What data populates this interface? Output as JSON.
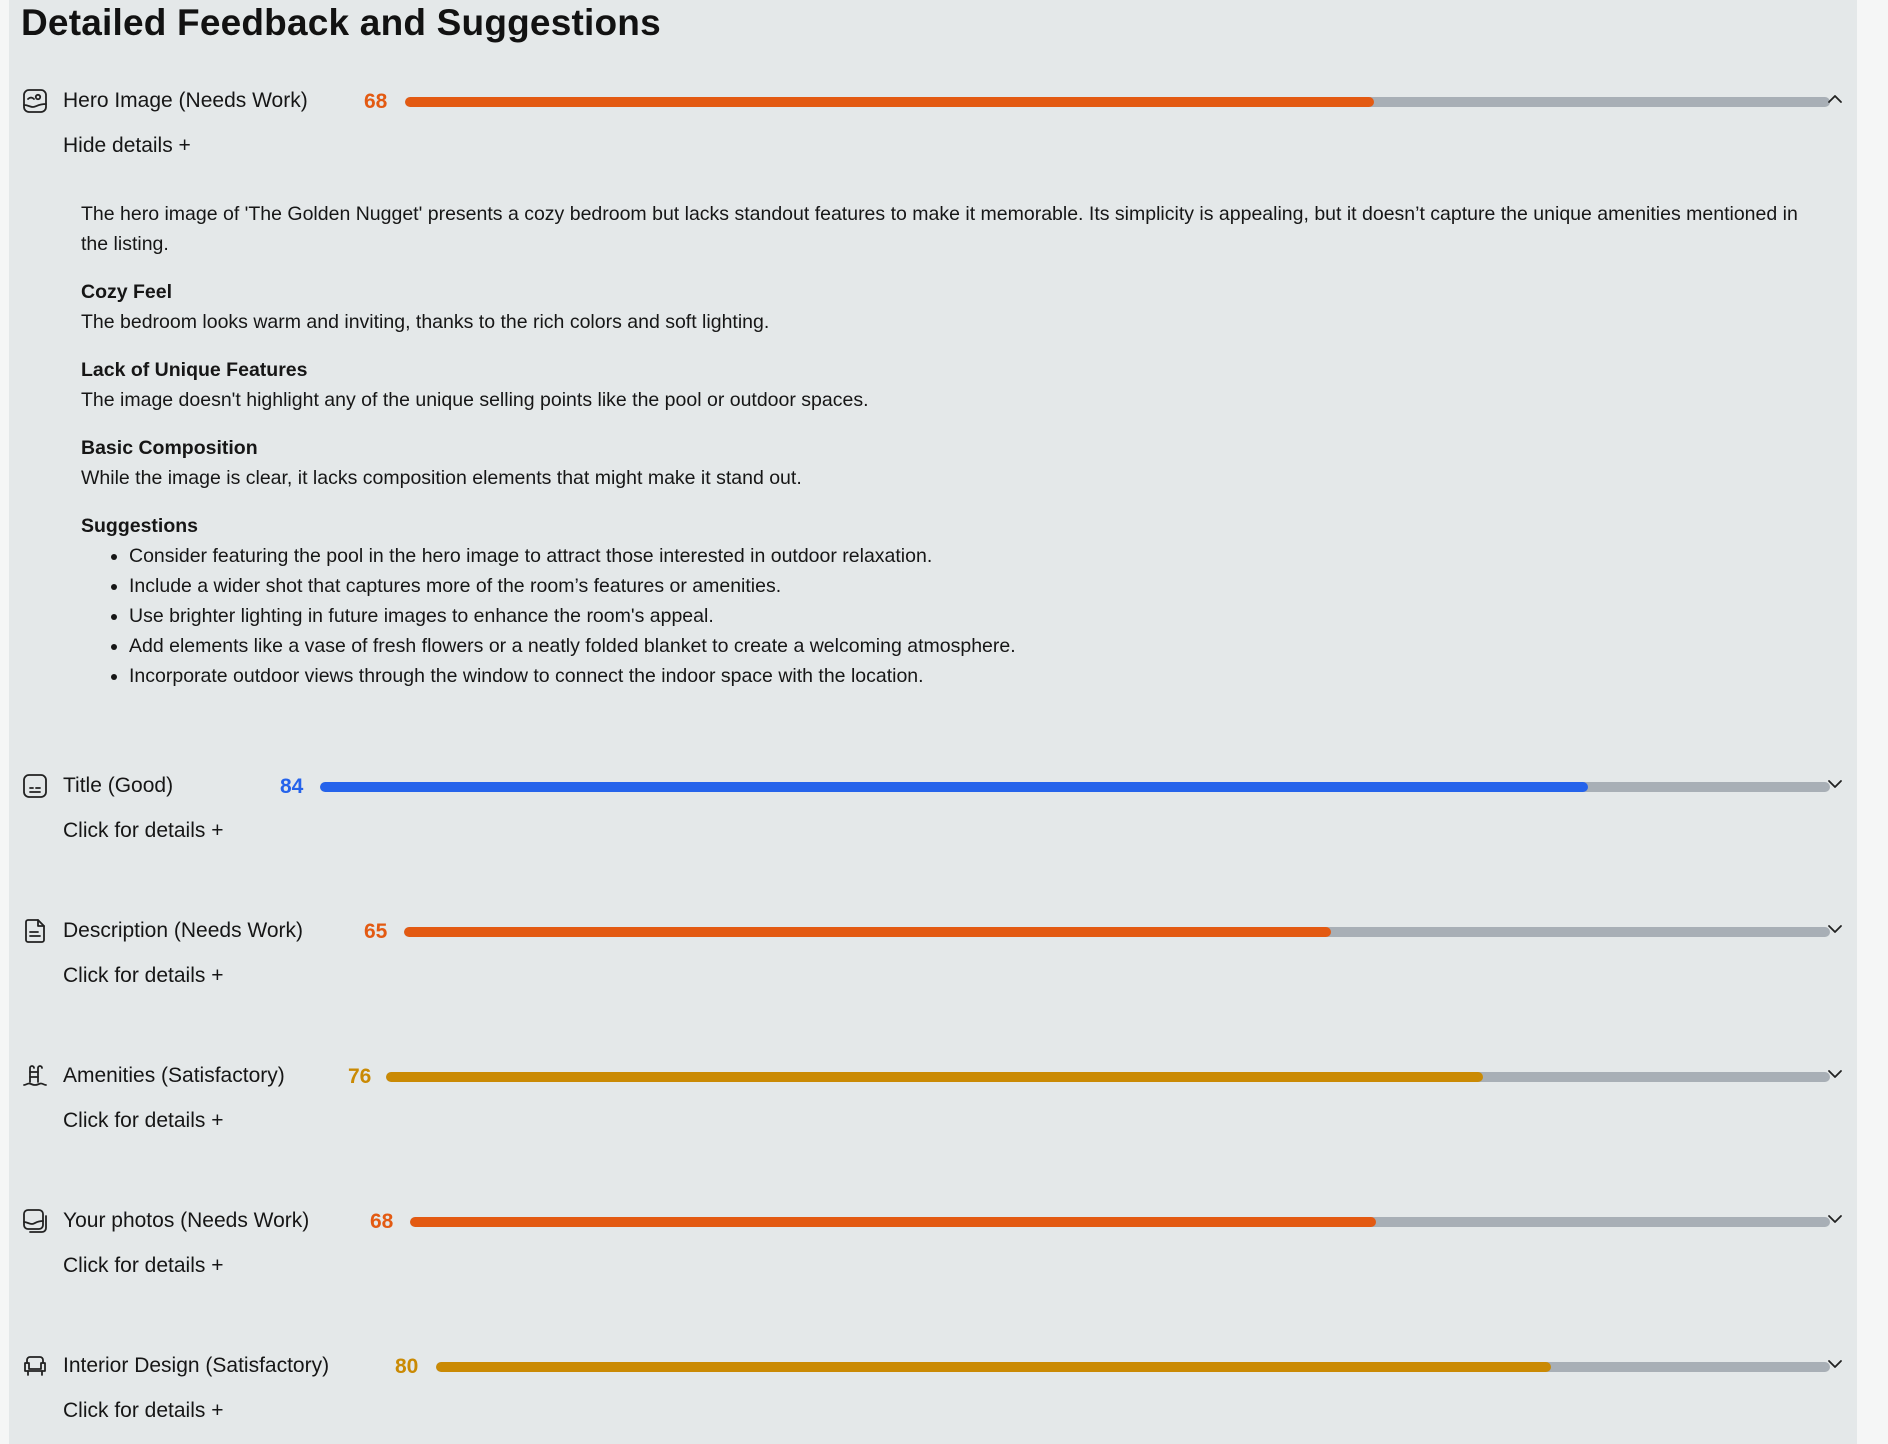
{
  "page_title": "Detailed Feedback and Suggestions",
  "colors": {
    "needs_work": "#e35a12",
    "good": "#2563eb",
    "satisfactory": "#ca8a04",
    "track": "#a8afb6",
    "background": "#e4e8e9"
  },
  "sections": [
    {
      "title": "Hero Image (Needs Work)",
      "score": "68",
      "level": 0.68,
      "toggle": "Hide details +",
      "icon": "image-icon",
      "chevron": "chevron-up-icon",
      "expanded": true
    },
    {
      "title": "Title (Good)",
      "score": "84",
      "level": 0.84,
      "toggle": "Click for details +",
      "icon": "caption-icon",
      "chevron": "chevron-down-icon"
    },
    {
      "title": "Description (Needs Work)",
      "score": "65",
      "level": 0.65,
      "toggle": "Click for details +",
      "icon": "document-icon",
      "chevron": "chevron-down-icon"
    },
    {
      "title": "Amenities (Satisfactory)",
      "score": "76",
      "level": 0.76,
      "toggle": "Click for details +",
      "icon": "pool-ladder-icon",
      "chevron": "chevron-down-icon"
    },
    {
      "title": "Your photos (Needs Work)",
      "score": "68",
      "level": 0.68,
      "toggle": "Click for details +",
      "icon": "photos-icon",
      "chevron": "chevron-down-icon"
    },
    {
      "title": "Interior Design (Satisfactory)",
      "score": "80",
      "level": 0.8,
      "toggle": "Click for details +",
      "icon": "armchair-icon",
      "chevron": "chevron-down-icon"
    }
  ],
  "hero_details": {
    "summary": "The hero image of 'The Golden Nugget' presents a cozy bedroom but lacks standout features to make it memorable. Its simplicity is appealing, but it doesn’t capture the unique amenities mentioned in the listing.",
    "blocks": [
      {
        "title": "Cozy Feel",
        "text": "The bedroom looks warm and inviting, thanks to the rich colors and soft lighting."
      },
      {
        "title": "Lack of Unique Features",
        "text": "The image doesn't highlight any of the unique selling points like the pool or outdoor spaces."
      },
      {
        "title": "Basic Composition",
        "text": "While the image is clear, it lacks composition elements that might make it stand out."
      }
    ],
    "suggestions_title": "Suggestions",
    "suggestions": [
      "Consider featuring the pool in the hero image to attract those interested in outdoor relaxation.",
      "Include a wider shot that captures more of the room’s features or amenities.",
      "Use brighter lighting in future images to enhance the room's appeal.",
      "Add elements like a vase of fresh flowers or a neatly folded blanket to create a welcoming atmosphere.",
      "Incorporate outdoor views through the window to connect the indoor space with the location."
    ]
  }
}
